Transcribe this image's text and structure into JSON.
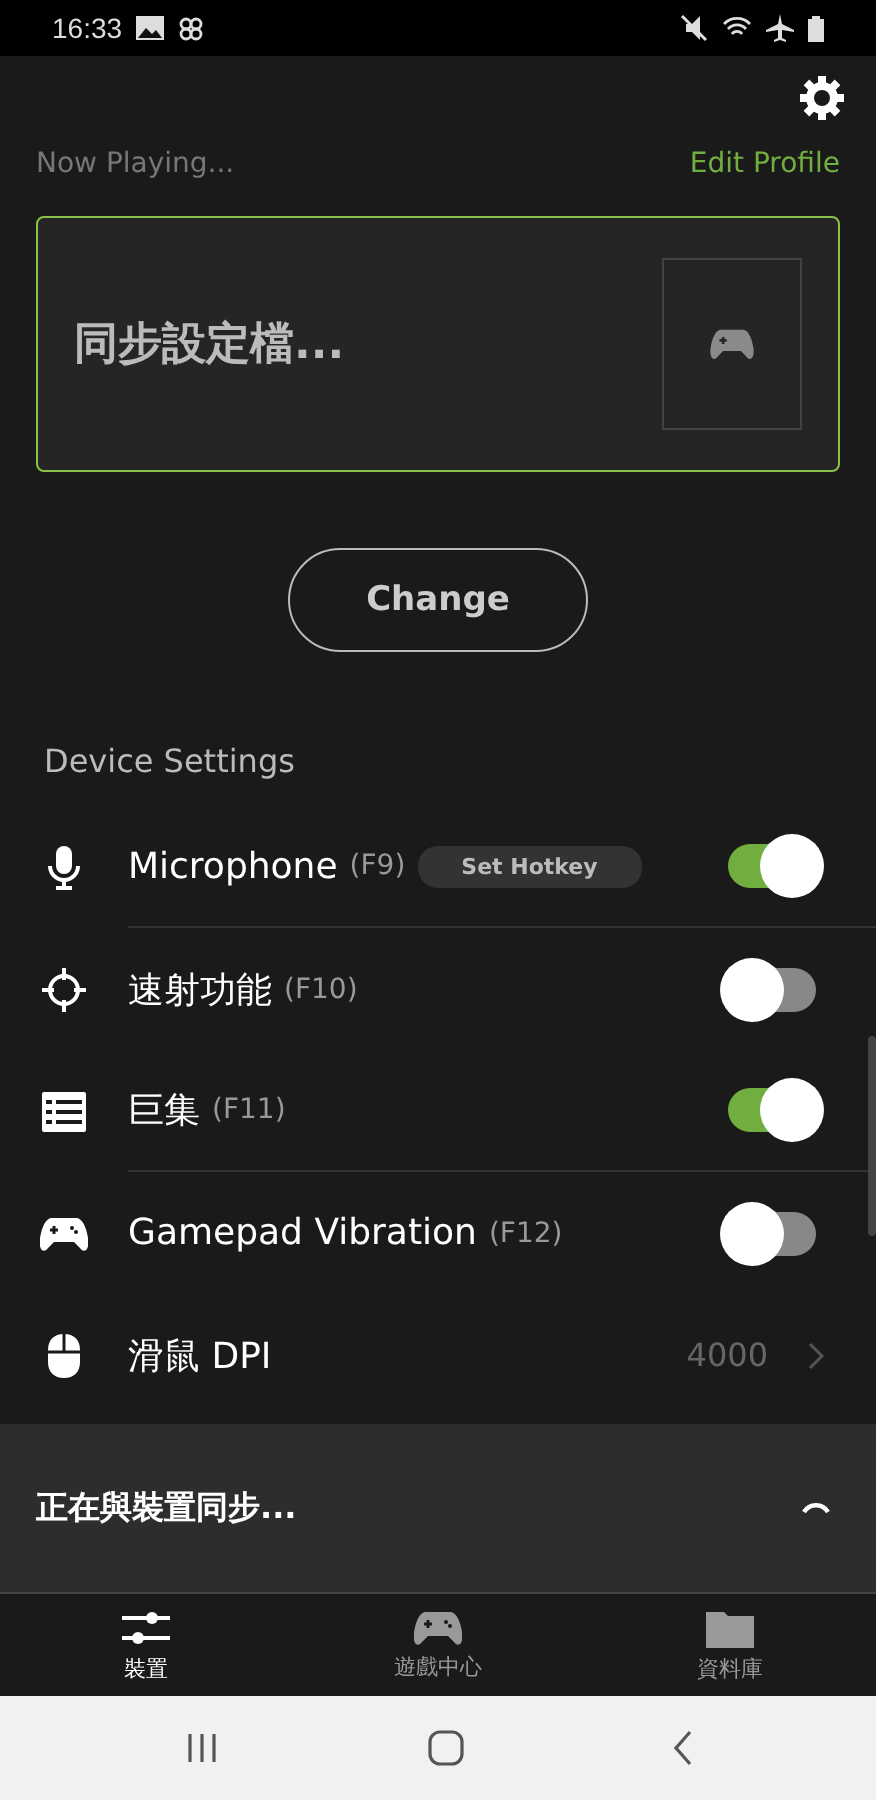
{
  "status_bar": {
    "time": "16:33"
  },
  "now_playing": {
    "label": "Now Playing...",
    "edit_link": "Edit Profile"
  },
  "profile_card": {
    "name": "同步設定檔..."
  },
  "change_button": "Change",
  "section_title": "Device Settings",
  "settings": [
    {
      "kind": "toggle",
      "label": "Microphone",
      "hotkey": "(F9)",
      "hotkey_button": "Set Hotkey",
      "on": true
    },
    {
      "kind": "toggle",
      "label": "速射功能",
      "hotkey": "(F10)",
      "on": false
    },
    {
      "kind": "toggle",
      "label": "巨集",
      "hotkey": "(F11)",
      "on": true
    },
    {
      "kind": "toggle",
      "label": "Gamepad Vibration",
      "hotkey": "(F12)",
      "on": false
    },
    {
      "kind": "value",
      "label": "滑鼠 DPI",
      "value": "4000"
    }
  ],
  "sync_panel": {
    "message": "正在與裝置同步..."
  },
  "bottom_tabs": [
    {
      "label": "裝置",
      "selected": true
    },
    {
      "label": "遊戲中心",
      "selected": false
    },
    {
      "label": "資料庫",
      "selected": false
    }
  ]
}
